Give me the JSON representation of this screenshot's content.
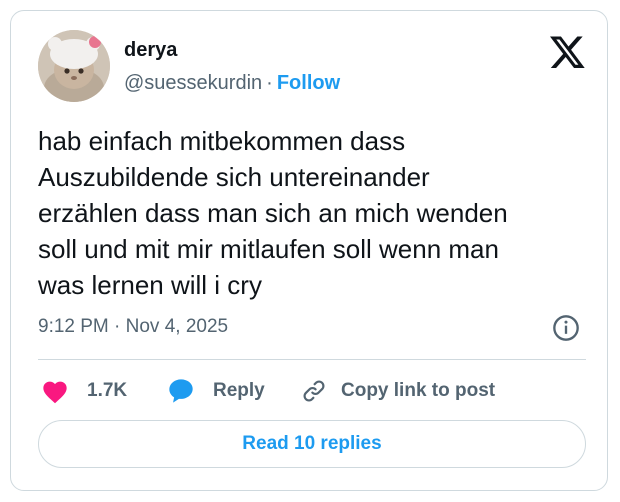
{
  "author": {
    "name": "derya",
    "handle": "@suessekurdin",
    "separator": "·",
    "follow_label": "Follow"
  },
  "tweet": {
    "lines": [
      "hab einfach mitbekommen dass",
      "Auszubildende sich untereinander",
      "erzählen dass man sich an mich wenden",
      "soll und mit mir mitlaufen soll wenn man",
      "was lernen will i cry"
    ],
    "timestamp": "9:12 PM · Nov 4, 2025"
  },
  "actions": {
    "like_count": "1.7K",
    "reply_label": "Reply",
    "copy_label": "Copy link to post"
  },
  "footer": {
    "read_replies_label": "Read 10 replies"
  },
  "colors": {
    "text": "#0f1419",
    "secondary": "#536471",
    "accent": "#1d9bf0",
    "like": "#f91880",
    "border": "#cfd9de"
  },
  "icons": {
    "brand": "x-logo-icon",
    "info": "info-icon",
    "like": "heart-icon",
    "reply": "reply-bubble-icon",
    "copy": "link-icon"
  }
}
